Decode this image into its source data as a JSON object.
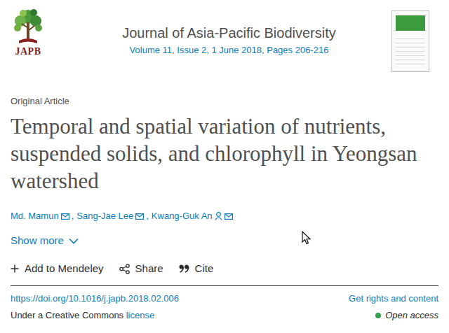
{
  "logo": {
    "text": "JAPB"
  },
  "journal": {
    "title": "Journal of Asia-Pacific Biodiversity",
    "issue": "Volume 11, Issue 2, 1 June 2018, Pages 206-216"
  },
  "article": {
    "type": "Original Article",
    "title": "Temporal and spatial variation of nutrients, suspended solids, and chlorophyll in Yeongsan watershed",
    "authors": [
      {
        "name": "Md. Mamun",
        "corresponding": false,
        "separator": ","
      },
      {
        "name": "Sang-Jae Lee",
        "corresponding": false,
        "separator": ","
      },
      {
        "name": "Kwang-Guk An",
        "corresponding": true,
        "separator": ""
      }
    ],
    "show_more": "Show more"
  },
  "actions": [
    {
      "label": "Add to Mendeley",
      "kind": "plus"
    },
    {
      "label": "Share",
      "kind": "share"
    },
    {
      "label": "Cite",
      "kind": "cite"
    }
  ],
  "doi": "https://doi.org/10.1016/j.japb.2018.02.006",
  "rights": "Get rights and content",
  "license": {
    "prefix": "Under a Creative Commons",
    "link": "license"
  },
  "access": {
    "label": "Open access"
  }
}
